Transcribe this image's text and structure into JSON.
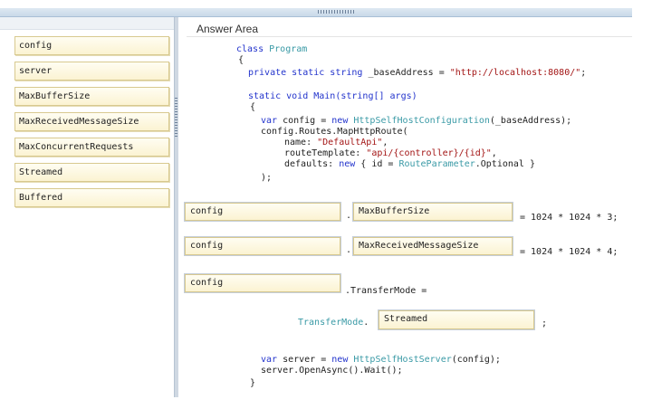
{
  "answer_area_title": "Answer Area",
  "drag_items": [
    "config",
    "server",
    "MaxBufferSize",
    "MaxReceivedMessageSize",
    "MaxConcurrentRequests",
    "Streamed",
    "Buffered"
  ],
  "code": {
    "class_kw": "class",
    "class_name": "Program",
    "open_brace": "{",
    "field_mods": "private static string",
    "field_rest": " _baseAddress = ",
    "field_value": "\"http://localhost:8080/\"",
    "field_end": ";",
    "main_sig": "static void Main(string[] args)",
    "main_open": "{",
    "var_kw": "var",
    "config_assign": " config = ",
    "new_kw": "new",
    "config_type": "HttpSelfHostConfiguration",
    "config_args": "(_baseAddress);",
    "map_route": "config.Routes.MapHttpRoute(",
    "name_label": "name: ",
    "name_value": "\"DefaultApi\"",
    "name_end": ",",
    "route_label": "routeTemplate: ",
    "route_value": "\"api/{controller}/{id}\"",
    "route_end": ",",
    "defaults_label": "defaults: ",
    "defaults_new": "new",
    "defaults_mid": " { id = ",
    "route_param": "RouteParameter",
    "defaults_end": ".Optional }",
    "map_close": ");",
    "dot1": ".",
    "assign1": "= 1024 * 1024 * 3;",
    "dot2": ".",
    "assign2": "= 1024 * 1024 * 4;",
    "transfer_mode": ".TransferMode =",
    "transfer_mode_type": "TransferMode",
    "transfer_dot": ".",
    "transfer_end": ";",
    "server_var": "var",
    "server_assign": " server = ",
    "server_new": "new",
    "server_type": "HttpSelfHostServer",
    "server_args": "(config);",
    "open_async": "server.OpenAsync().Wait();",
    "close_brace": "}"
  },
  "slots": {
    "row1_target": "config",
    "row1_property": "MaxBufferSize",
    "row2_target": "config",
    "row2_property": "MaxReceivedMessageSize",
    "row3_target": "config",
    "row4_value": "Streamed"
  }
}
